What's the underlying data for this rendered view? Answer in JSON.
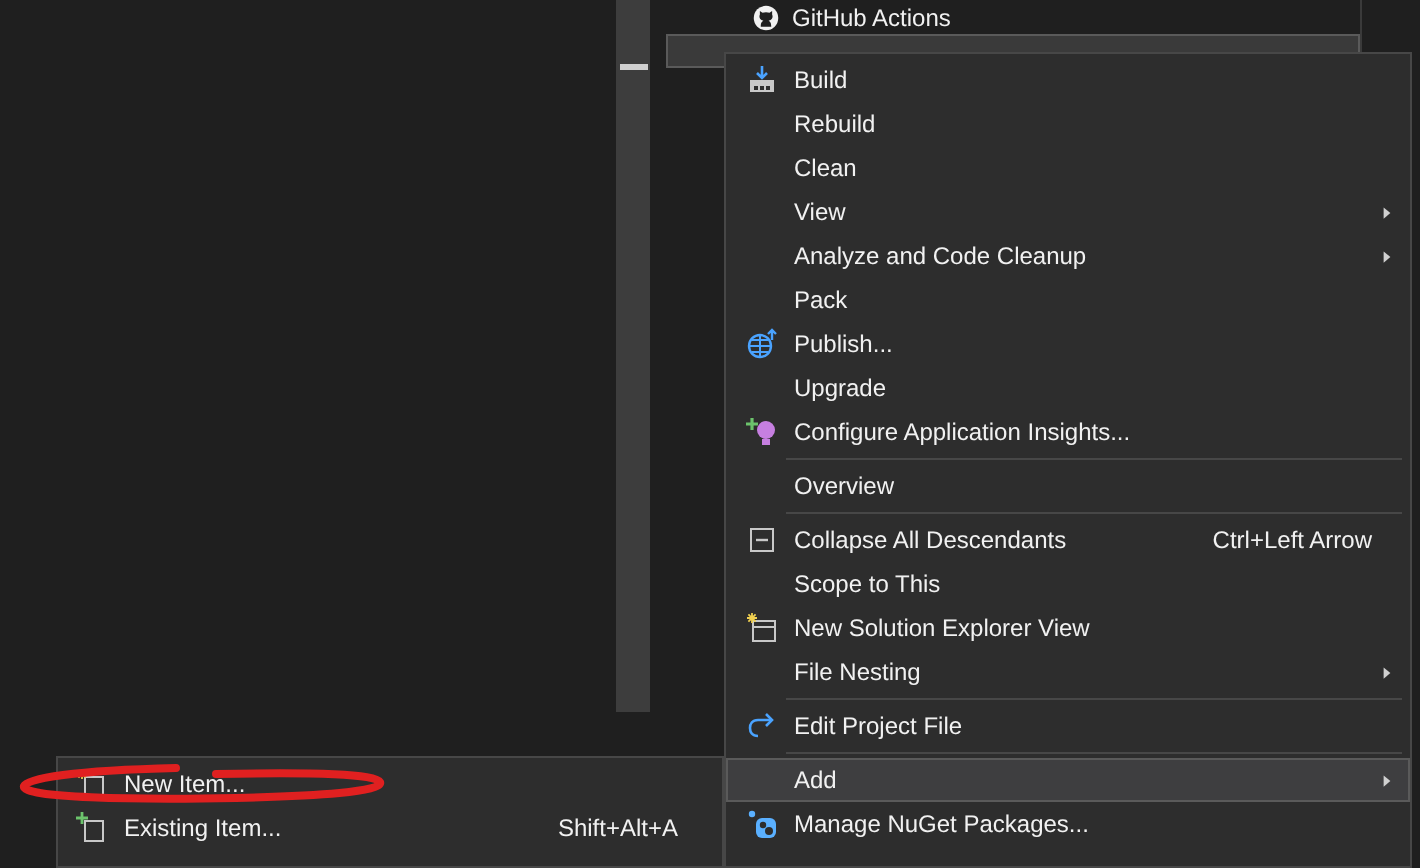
{
  "tree": {
    "items": [
      {
        "label": "GitHub Actions",
        "selected": false
      },
      {
        "selected": true
      }
    ]
  },
  "context_menu": {
    "items": [
      {
        "kind": "item",
        "label": "Build",
        "selected": false
      },
      {
        "kind": "item",
        "label": "Rebuild",
        "selected": false
      },
      {
        "kind": "item",
        "label": "Clean",
        "selected": false
      },
      {
        "kind": "item",
        "label": "View",
        "submenu": true,
        "selected": false
      },
      {
        "kind": "item",
        "label": "Analyze and Code Cleanup",
        "submenu": true,
        "selected": false
      },
      {
        "kind": "item",
        "label": "Pack",
        "selected": false
      },
      {
        "kind": "item",
        "label": "Publish...",
        "selected": false
      },
      {
        "kind": "item",
        "label": "Upgrade",
        "selected": false
      },
      {
        "kind": "item",
        "label": "Configure Application Insights...",
        "selected": false
      },
      {
        "kind": "separator"
      },
      {
        "kind": "item",
        "label": "Overview",
        "selected": false
      },
      {
        "kind": "separator"
      },
      {
        "kind": "item",
        "label": "Collapse All Descendants",
        "shortcut": "Ctrl+Left Arrow",
        "selected": false
      },
      {
        "kind": "item",
        "label": "Scope to This",
        "selected": false
      },
      {
        "kind": "item",
        "label": "New Solution Explorer View",
        "selected": false
      },
      {
        "kind": "item",
        "label": "File Nesting",
        "submenu": true,
        "selected": false
      },
      {
        "kind": "separator"
      },
      {
        "kind": "item",
        "label": "Edit Project File",
        "selected": false
      },
      {
        "kind": "separator"
      },
      {
        "kind": "item",
        "label": "Add",
        "submenu": true,
        "selected": true
      },
      {
        "kind": "item",
        "label": "Manage NuGet Packages...",
        "selected": false
      }
    ]
  },
  "add_submenu": {
    "items": [
      {
        "label": "New Item...",
        "annotated": true
      },
      {
        "label": "Existing Item...",
        "shortcut": "Shift+Alt+A",
        "annotated": false
      }
    ]
  }
}
